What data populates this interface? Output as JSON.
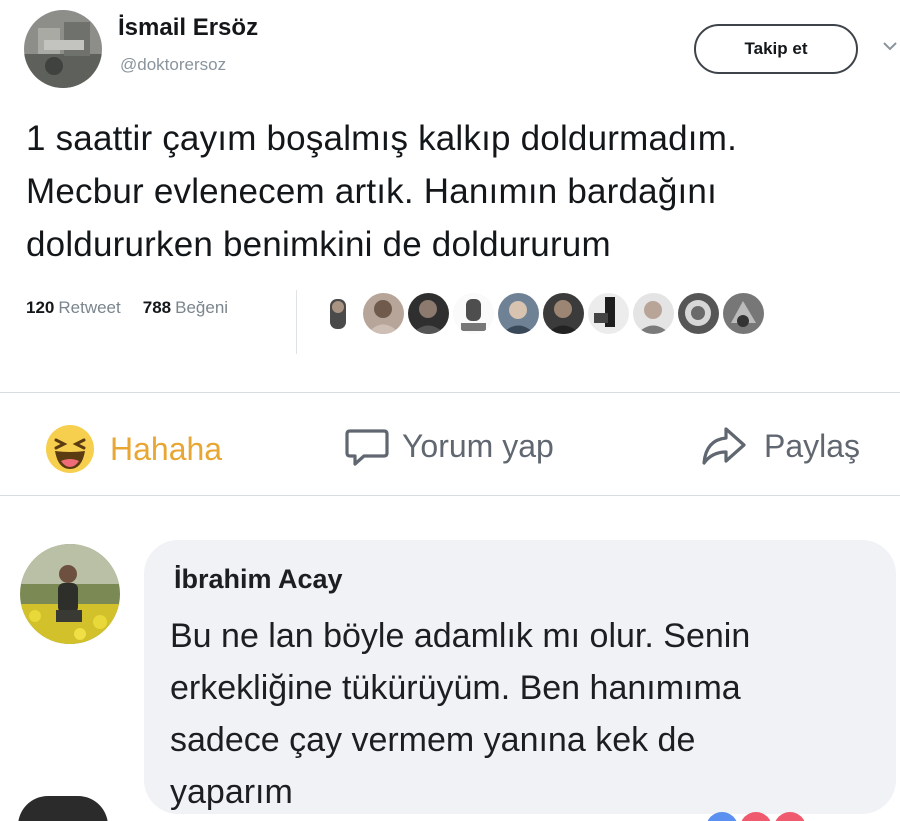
{
  "tweet": {
    "display_name": "İsmail Ersöz",
    "handle": "@doktorersoz",
    "follow_label": "Takip et",
    "text_lines": [
      "1 saattir çayım boşalmış kalkıp doldurmadım.",
      "Mecbur evlenecem artık. Hanımın bardağını",
      "doldururken benimkini de doldururum"
    ],
    "retweet_count": "120",
    "retweet_label": "Retweet",
    "like_count": "788",
    "like_label": "Beğeni",
    "liker_avatars": 10
  },
  "actions": {
    "haha_label": "Hahaha",
    "comment_label": "Yorum yap",
    "share_label": "Paylaş"
  },
  "comment": {
    "author": "İbrahim Acay",
    "text_lines": [
      "Bu ne lan böyle adamlık mı olur. Senin",
      "erkekliğine tükürüyüm. Ben hanımıma",
      "sadece çay vermem yanına kek de",
      "yaparım"
    ]
  },
  "colors": {
    "haha_yellow": "#e8a633",
    "bubble_bg": "#f0f2f5",
    "muted_gray": "#606770"
  },
  "icons": {
    "haha": "laughing-face-icon",
    "comment": "speech-bubble-icon",
    "share": "share-arrow-icon",
    "menu": "chevron-down-icon"
  }
}
